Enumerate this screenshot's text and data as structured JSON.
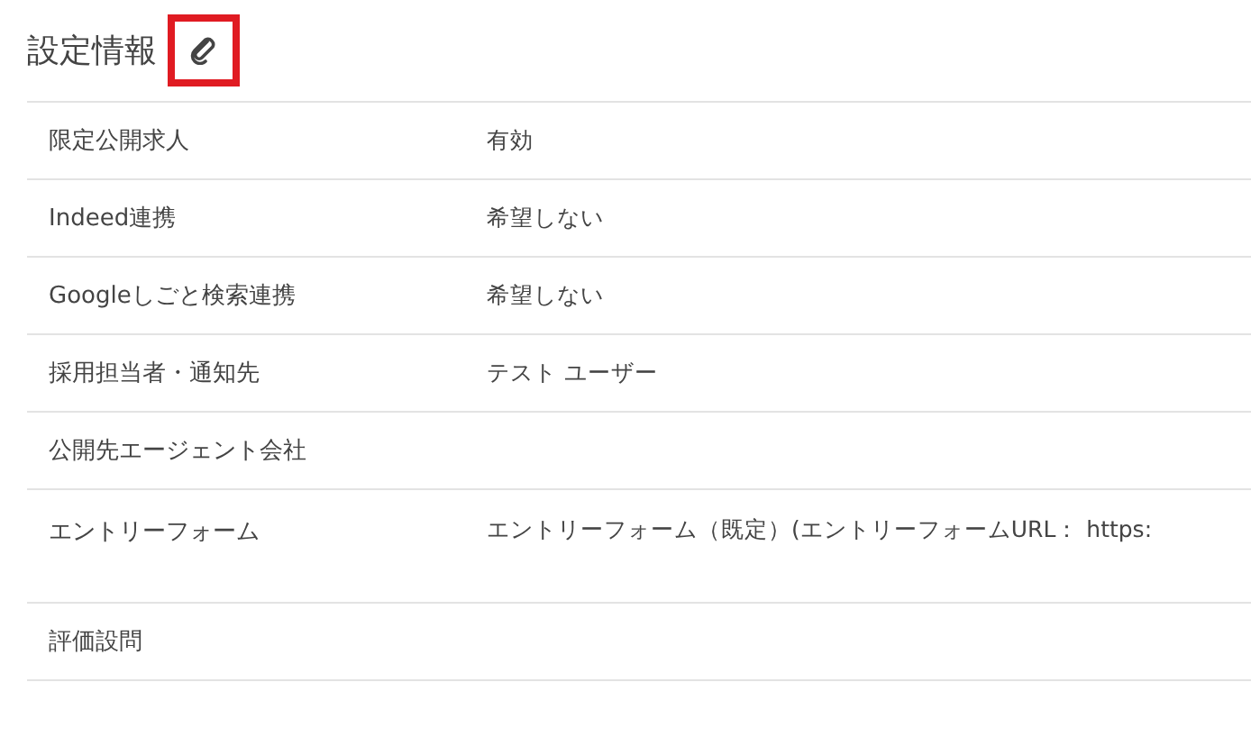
{
  "section": {
    "title": "設定情報",
    "edit_highlighted": true
  },
  "rows": [
    {
      "label": "限定公開求人",
      "value": "有効"
    },
    {
      "label": "Indeed連携",
      "value": "希望しない"
    },
    {
      "label": "Googleしごと検索連携",
      "value": "希望しない"
    },
    {
      "label": "採用担当者・通知先",
      "value": "テスト ユーザー"
    },
    {
      "label": "公開先エージェント会社"
    },
    {
      "label": "エントリーフォーム",
      "value": "エントリーフォーム（既定）(エントリーフォームURL： https:",
      "tall": true
    },
    {
      "label": "評価設問"
    }
  ]
}
